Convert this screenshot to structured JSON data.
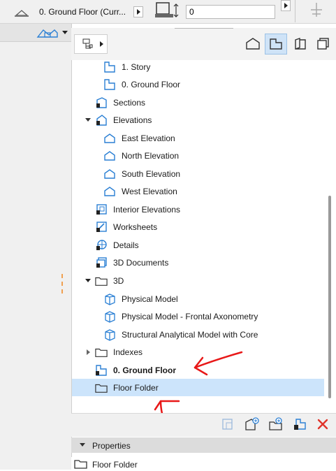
{
  "toolbar": {
    "story_label": "0. Ground Floor (Curr...",
    "elevation_value": "0"
  },
  "navigator": {
    "tree": [
      {
        "label": "1. Story",
        "icon": "story-icon",
        "bold": false
      },
      {
        "label": "0. Ground Floor",
        "icon": "story-icon",
        "bold": false
      },
      {
        "label": "Sections",
        "icon": "section-icon",
        "bold": false
      },
      {
        "label": "Elevations",
        "icon": "elevation-icon",
        "bold": false
      },
      {
        "label": "East Elevation",
        "icon": "elevation-view-icon",
        "bold": false
      },
      {
        "label": "North Elevation",
        "icon": "elevation-view-icon",
        "bold": false
      },
      {
        "label": "South Elevation",
        "icon": "elevation-view-icon",
        "bold": false
      },
      {
        "label": "West Elevation",
        "icon": "elevation-view-icon",
        "bold": false
      },
      {
        "label": "Interior Elevations",
        "icon": "interior-elevation-icon",
        "bold": false
      },
      {
        "label": "Worksheets",
        "icon": "worksheet-icon",
        "bold": false
      },
      {
        "label": "Details",
        "icon": "detail-icon",
        "bold": false
      },
      {
        "label": "3D Documents",
        "icon": "3d-document-icon",
        "bold": false
      },
      {
        "label": "3D",
        "icon": "folder-icon",
        "bold": false
      },
      {
        "label": "Physical Model",
        "icon": "3d-view-icon",
        "bold": false
      },
      {
        "label": "Physical Model - Frontal Axonometry",
        "icon": "3d-view-icon",
        "bold": false
      },
      {
        "label": "Structural Analytical Model with Core",
        "icon": "3d-view-icon",
        "bold": false
      },
      {
        "label": "Indexes",
        "icon": "folder-icon",
        "bold": false
      },
      {
        "label": "0. Ground Floor",
        "icon": "story-icon",
        "bold": true
      },
      {
        "label": "Floor Folder",
        "icon": "folder-icon",
        "bold": false
      }
    ]
  },
  "properties": {
    "header": "Properties",
    "value": "Floor Folder"
  },
  "colors": {
    "selection": "#cce4fb",
    "active_tab": "#cfe3f7",
    "icon_blue": "#2a7fd4",
    "delete_red": "#e0342a",
    "annotation_red": "#e81818"
  }
}
